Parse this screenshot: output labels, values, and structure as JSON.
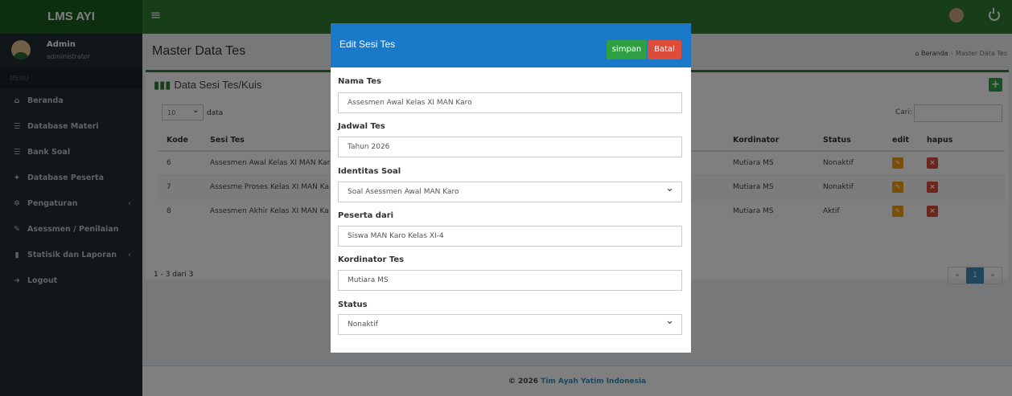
{
  "app": {
    "logo": "LMS AYI",
    "menu_toggle": "≡"
  },
  "user": {
    "name": "Admin",
    "role": "administrator"
  },
  "sidebar": {
    "header": "MENU",
    "items": [
      {
        "icon": "home-icon",
        "glyph": "⌂",
        "label": "Beranda"
      },
      {
        "icon": "database-icon",
        "glyph": "☰",
        "label": "Database Materi"
      },
      {
        "icon": "database-icon",
        "glyph": "☰",
        "label": "Bank Soal"
      },
      {
        "icon": "users-icon",
        "glyph": "✦",
        "label": "Database Peserta"
      },
      {
        "icon": "gear-icon",
        "glyph": "✲",
        "label": "Pengaturan",
        "chevron": "‹"
      },
      {
        "icon": "edit-icon",
        "glyph": "✎",
        "label": "Asessmen / Penilaian"
      },
      {
        "icon": "bar-chart-icon",
        "glyph": "▮",
        "label": "Statisik dan Laporan",
        "chevron": "‹"
      },
      {
        "icon": "logout-icon",
        "glyph": "➔",
        "label": "Logout"
      }
    ]
  },
  "page": {
    "title": "Master Data Tes",
    "breadcrumb": {
      "home": "Beranda",
      "current": "Master Data Tes"
    }
  },
  "box": {
    "title": "Data Sesi Tes/Kuis",
    "length": {
      "value": "10",
      "suffix": "data"
    },
    "search_label": "Cari:",
    "columns": [
      "Kode",
      "Sesi Tes",
      "Kordinator",
      "Status",
      "edit",
      "hapus"
    ],
    "rows": [
      {
        "kode": "6",
        "sesi": "Assesmen Awal Kelas XI MAN Kar",
        "kordinator": "Mutiara MS",
        "status": "Nonaktif"
      },
      {
        "kode": "7",
        "sesi": "Assesme Proses Kelas XI MAN Ka",
        "kordinator": "Mutiara MS",
        "status": "Nonaktif"
      },
      {
        "kode": "8",
        "sesi": "Assesmen Akhir Kelas XI MAN Ka",
        "kordinator": "Mutiara MS",
        "status": "Aktif"
      }
    ],
    "info": "1 - 3 dari 3",
    "pager": {
      "prev": "«",
      "current": "1",
      "next": "»"
    }
  },
  "footer": {
    "prefix": "© 2026",
    "brand": "Tim Ayah Yatim Indonesia"
  },
  "modal": {
    "title": "Edit Sesi Tes",
    "save_label": "simpan",
    "cancel_label": "Batal",
    "fields": {
      "nama_tes": {
        "label": "Nama Tes",
        "value": "Assesmen Awal Kelas XI MAN Karo"
      },
      "jadwal_tes": {
        "label": "Jadwal Tes",
        "value": "Tahun 2026"
      },
      "identitas_soal": {
        "label": "Identitas Soal",
        "value": "Soal Asessmen Awal MAN Karo"
      },
      "peserta_dari": {
        "label": "Peserta dari",
        "value": "Siswa MAN Karo Kelas XI-4"
      },
      "kordinator": {
        "label": "Kordinator Tes",
        "value": "Mutiara MS"
      },
      "status": {
        "label": "Status",
        "value": "Nonaktif"
      }
    }
  },
  "colors": {
    "header": "#2e7d32",
    "sidebar": "#222d32",
    "modal_header": "#1a79c9",
    "save": "#2ea043",
    "cancel": "#dd4b39"
  }
}
